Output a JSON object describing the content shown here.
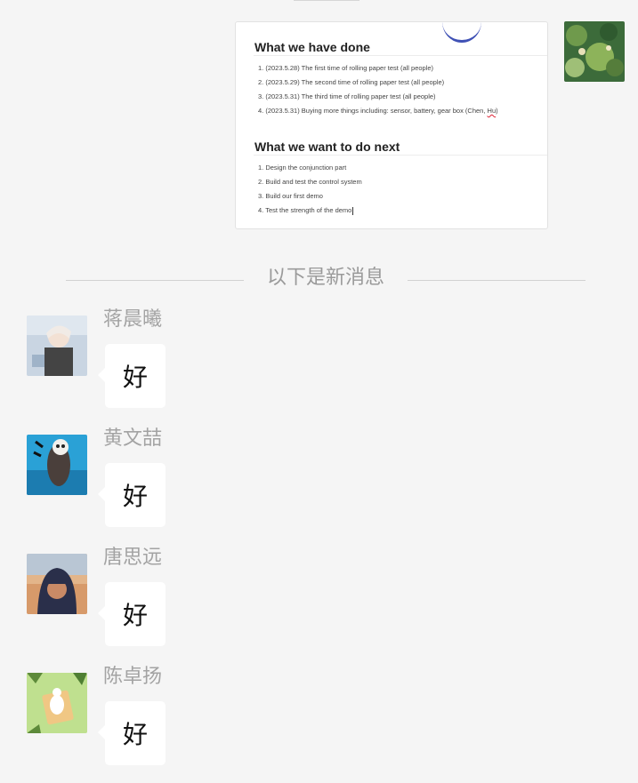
{
  "sent_document": {
    "section1_title": "What we have done",
    "section1_items": [
      "1. (2023.5.28) The first time of rolling paper test (all people)",
      "2. (2023.5.29) The second time of rolling paper test (all people)",
      "3. (2023.5.31) The third time of rolling paper test (all people)",
      "4. (2023.5.31) Buying more things including: sensor, battery, gear box (Chen,"
    ],
    "section1_item4_tail": "Hu",
    "section1_item4_close": ")",
    "section2_title": "What we want to do next",
    "section2_items": [
      "1. Design the conjunction part",
      "2. Build and test the control system",
      "3. Build our first demo",
      "4. Test the strength of the demo"
    ]
  },
  "new_messages_divider": "以下是新消息",
  "messages": [
    {
      "sender": "蒋晨曦",
      "text": "好"
    },
    {
      "sender": "黄文喆",
      "text": "好"
    },
    {
      "sender": "唐思远",
      "text": "好"
    },
    {
      "sender": "陈卓扬",
      "text": "好"
    }
  ],
  "colors": {
    "background": "#f5f5f5",
    "bubble": "#ffffff",
    "sender_name": "#a3a3a3",
    "divider_text": "#9a9a9a"
  }
}
